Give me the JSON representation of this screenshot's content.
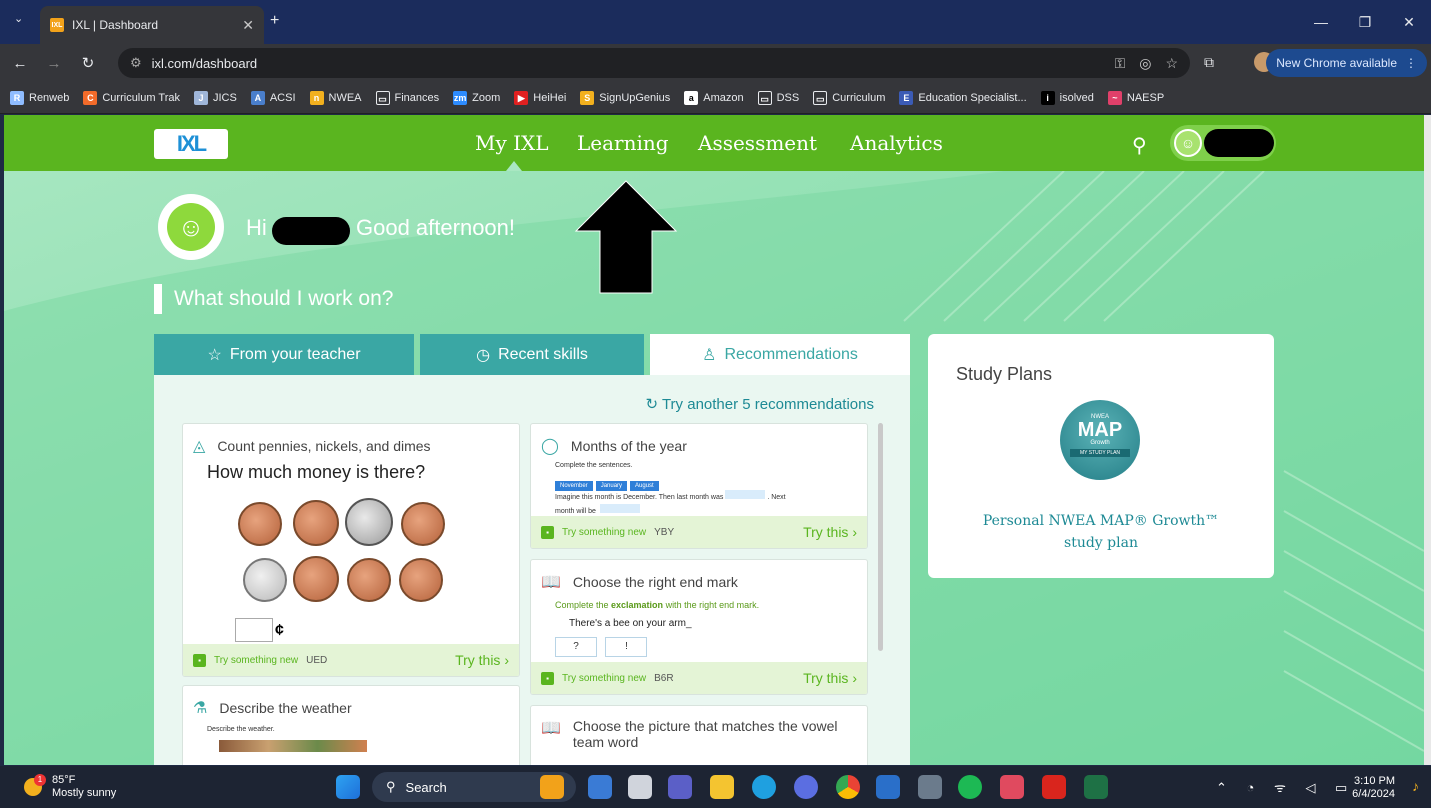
{
  "browser": {
    "tab_title": "IXL | Dashboard",
    "tab_favicon": "IXL",
    "url": "ixl.com/dashboard",
    "new_chrome_label": "New Chrome available",
    "bookmarks": [
      {
        "label": "Renweb",
        "icon": "R",
        "color": "#8fbcff"
      },
      {
        "label": "Curriculum Trak",
        "icon": "C",
        "color": "#f26b2a"
      },
      {
        "label": "JICS",
        "icon": "J",
        "color": "#9fb6d9"
      },
      {
        "label": "ACSI",
        "icon": "A",
        "color": "#4a7fcc"
      },
      {
        "label": "NWEA",
        "icon": "n",
        "color": "#f2b01e"
      },
      {
        "label": "Finances",
        "icon": "▭",
        "color": "#35363a"
      },
      {
        "label": "Zoom",
        "icon": "zm",
        "color": "#2d8cff"
      },
      {
        "label": "HeiHei",
        "icon": "▶",
        "color": "#e02020"
      },
      {
        "label": "SignUpGenius",
        "icon": "S",
        "color": "#f2b01e"
      },
      {
        "label": "Amazon",
        "icon": "a",
        "color": "#ffffff"
      },
      {
        "label": "DSS",
        "icon": "▭",
        "color": "#35363a"
      },
      {
        "label": "Curriculum",
        "icon": "▭",
        "color": "#35363a"
      },
      {
        "label": "Education Specialist...",
        "icon": "E",
        "color": "#3b5bb5"
      },
      {
        "label": "isolved",
        "icon": "i",
        "color": "#000000"
      },
      {
        "label": "NAESP",
        "icon": "~",
        "color": "#e0406a"
      }
    ]
  },
  "ixl": {
    "logo": "IXL",
    "nav": [
      "My IXL",
      "Learning",
      "Assessment",
      "Analytics"
    ],
    "greeting_hi": "Hi",
    "greeting_rest": "Good afternoon!",
    "question": "What should I work on?",
    "tabs": [
      "From your teacher",
      "Recent skills",
      "Recommendations"
    ],
    "try_another": "Try another 5 recommendations",
    "cards": {
      "money": {
        "title": "Count pennies, nickels, and dimes",
        "prompt": "How much money is there?",
        "cent": "¢",
        "footer": "Try something new",
        "code": "UED",
        "try": "Try this"
      },
      "months": {
        "title": "Months of the year",
        "line1": "Complete the sentences.",
        "chips": [
          "November",
          "January",
          "August"
        ],
        "line2": "Imagine this month is December. Then last month was",
        "line2b": ". Next",
        "line3": "month will be",
        "footer": "Try something new",
        "code": "YBY",
        "try": "Try this"
      },
      "endmark": {
        "title": "Choose the right end mark",
        "instr_a": "Complete the ",
        "instr_b": "exclamation",
        "instr_c": " with the right end mark.",
        "sentence": "There's a bee on your arm_",
        "opts": [
          "?",
          "!"
        ],
        "footer": "Try something new",
        "code": "B6R",
        "try": "Try this"
      },
      "weather": {
        "title": "Describe the weather",
        "line": "Describe the weather."
      },
      "vowel": {
        "title": "Choose the picture that matches the vowel team word"
      }
    },
    "study": {
      "title": "Study Plans",
      "map_small": "NWEA",
      "map_big": "MAP",
      "map_sub": "Growth",
      "map_band": "MY STUDY PLAN",
      "link": "Personal NWEA MAP® Growth™ study plan"
    }
  },
  "taskbar": {
    "temp": "85°F",
    "weather": "Mostly sunny",
    "weather_badge": "1",
    "search": "Search",
    "time": "3:10 PM",
    "date": "6/4/2024"
  }
}
